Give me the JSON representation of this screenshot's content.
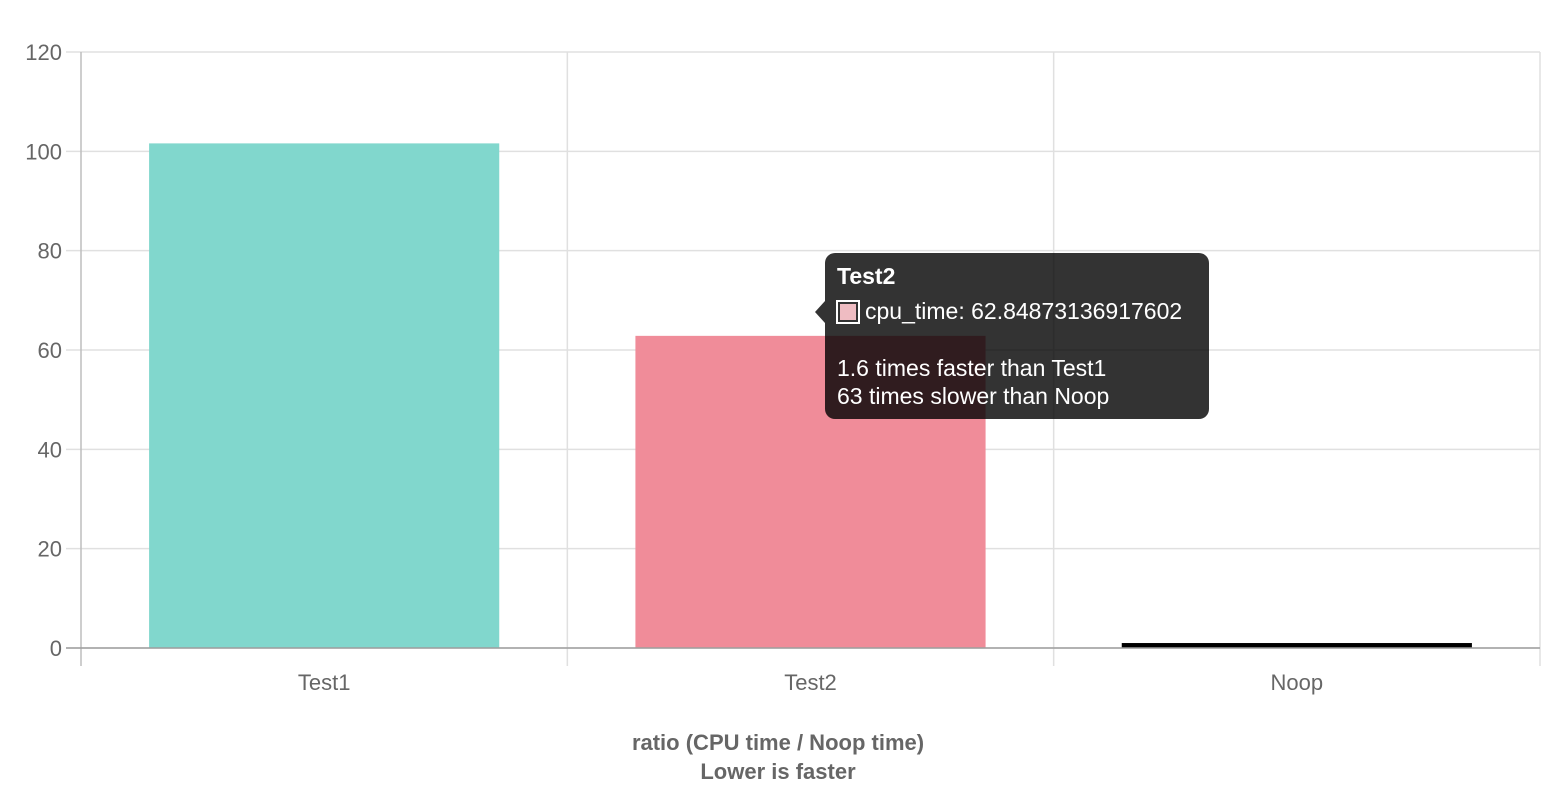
{
  "chart_data": {
    "type": "bar",
    "categories": [
      "Test1",
      "Test2",
      "Noop"
    ],
    "values": [
      101.6,
      62.84873136917602,
      1
    ],
    "series": [
      {
        "values": [
          101.6,
          62.84873136917602,
          1
        ]
      }
    ],
    "colors": [
      "#81d7cd",
      "#f08c99",
      "#000000"
    ],
    "xlabel": "ratio (CPU time / Noop time)",
    "xlabel_sub": "Lower is faster",
    "ylim": [
      0,
      120
    ],
    "yticks": [
      "0",
      "20",
      "40",
      "60",
      "80",
      "100",
      "120"
    ],
    "grid": true,
    "tooltip": {
      "title": "Test2",
      "swatch_color": "#efbcc2",
      "value_line": "cpu_time: 62.84873136917602",
      "lines": [
        "1.6 times faster than Test1",
        "63 times slower than Noop"
      ]
    }
  }
}
